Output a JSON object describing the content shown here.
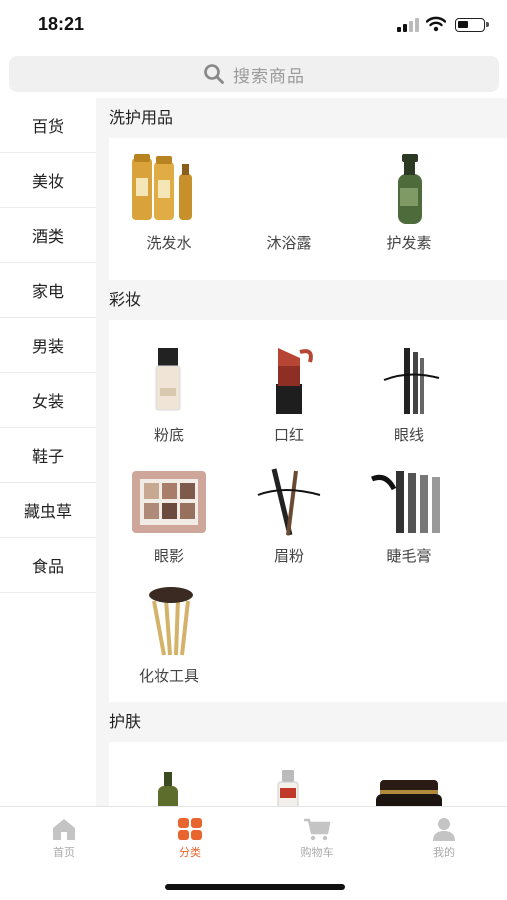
{
  "status": {
    "time": "18:21"
  },
  "search": {
    "placeholder": "搜索商品"
  },
  "categories": [
    "百货",
    "美妆",
    "酒类",
    "家电",
    "男装",
    "女装",
    "鞋子",
    "藏虫草",
    "食品"
  ],
  "sections": [
    {
      "title": "洗护用品",
      "items": [
        "洗发水",
        "沐浴露",
        "护发素"
      ]
    },
    {
      "title": "彩妆",
      "items": [
        "粉底",
        "口红",
        "眼线",
        "眼影",
        "眉粉",
        "睫毛膏",
        "化妆工具"
      ]
    },
    {
      "title": "护肤"
    }
  ],
  "tabs": [
    {
      "label": "首页",
      "icon": "home-icon"
    },
    {
      "label": "分类",
      "icon": "category-icon"
    },
    {
      "label": "购物车",
      "icon": "cart-icon"
    },
    {
      "label": "我的",
      "icon": "user-icon"
    }
  ],
  "colors": {
    "accent": "#e8652e",
    "inactive": "#aaaaaa",
    "background": "#f5f5f5"
  }
}
